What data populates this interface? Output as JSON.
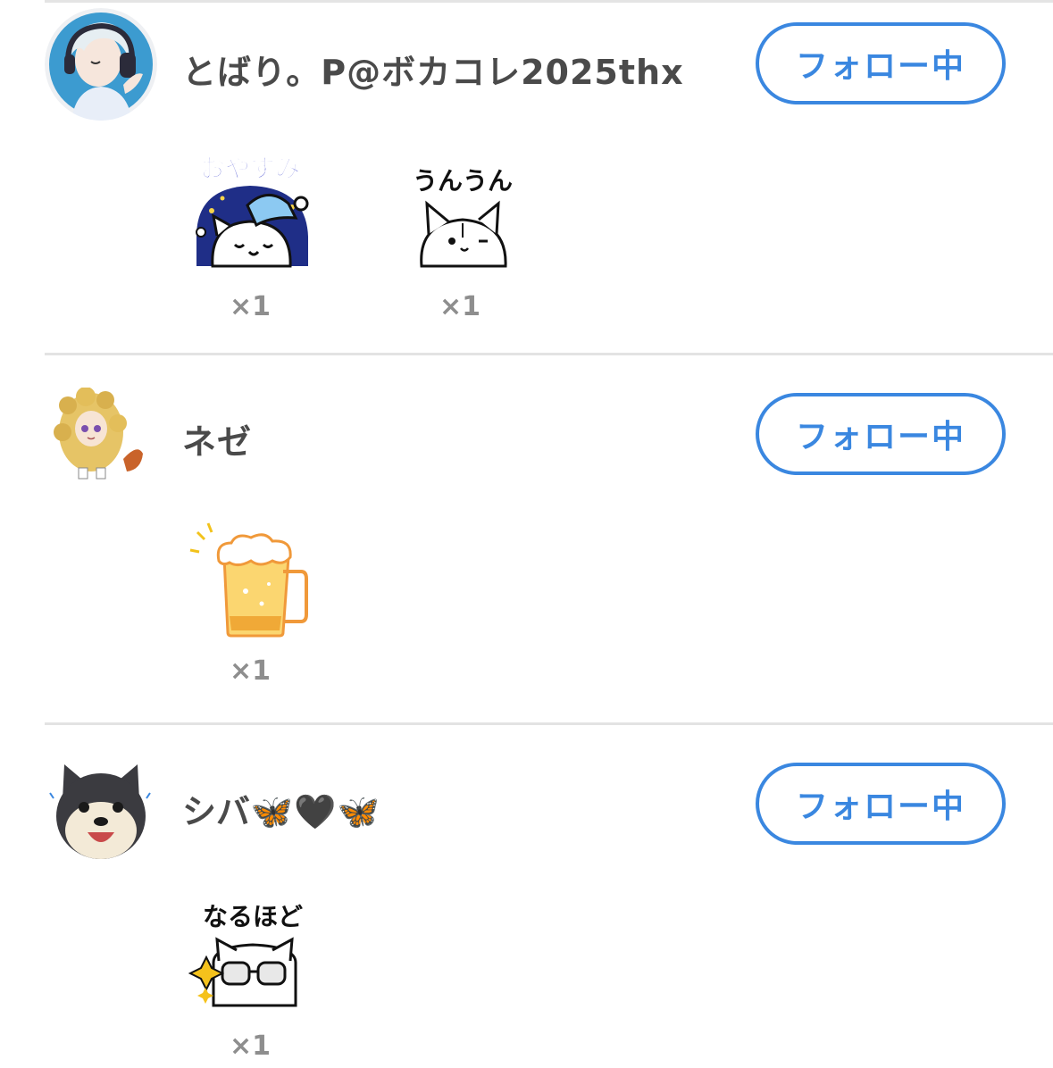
{
  "entries": [
    {
      "username": "とばり。P@ボカコレ2025thx",
      "follow_label": "フォロー中",
      "stamps": [
        {
          "label": "おやすみ",
          "count": "×1",
          "icon": "sleeping-cat-sticker"
        },
        {
          "label": "うんうん",
          "count": "×1",
          "icon": "nodding-cat-sticker"
        }
      ]
    },
    {
      "username": "ネゼ",
      "follow_label": "フォロー中",
      "stamps": [
        {
          "label": "",
          "count": "×1",
          "icon": "beer-mug-sticker"
        }
      ]
    },
    {
      "username": "シバ🦋🖤🦋",
      "follow_label": "フォロー中",
      "stamps": [
        {
          "label": "なるほど",
          "count": "×1",
          "icon": "glasses-cat-sticker"
        }
      ]
    }
  ],
  "colors": {
    "accent": "#3a87e0",
    "divider": "#e3e3e3",
    "count_text": "#8e8e8e",
    "username_text": "#4a4a4a"
  }
}
